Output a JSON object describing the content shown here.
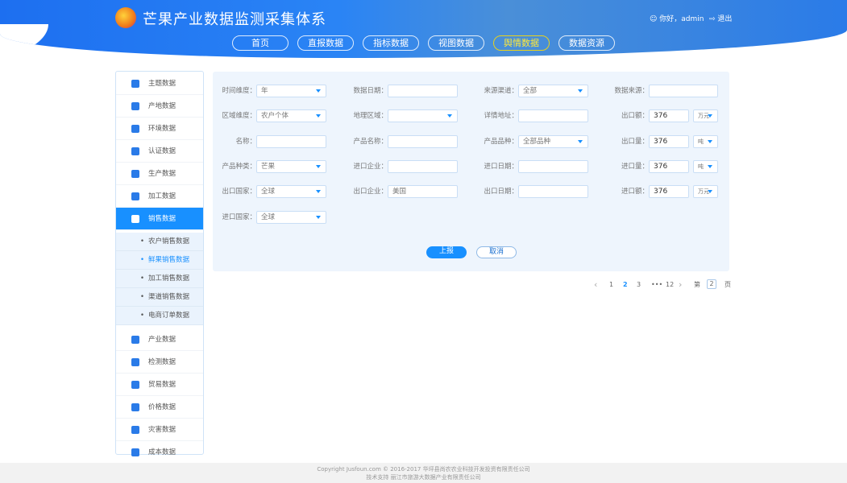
{
  "header": {
    "title": "芒果产业数据监测采集体系",
    "user": "你好，admin",
    "logout": "退出",
    "nav": [
      {
        "label": "首页"
      },
      {
        "label": "直报数据"
      },
      {
        "label": "指标数据"
      },
      {
        "label": "视图数据"
      },
      {
        "label": "舆情数据",
        "active": true
      },
      {
        "label": "数据资源"
      }
    ]
  },
  "sidebar": {
    "items": [
      "主题数据",
      "产地数据",
      "环境数据",
      "认证数据",
      "生产数据",
      "加工数据",
      "销售数据"
    ],
    "sub": [
      "农户销售数据",
      "鲜果销售数据",
      "加工销售数据",
      "渠道销售数据",
      "电商订单数据"
    ],
    "items2": [
      "产业数据",
      "检测数据",
      "贸易数据",
      "价格数据",
      "灾害数据",
      "成本数据"
    ],
    "active": "销售数据",
    "active_sub": "鲜果销售数据"
  },
  "form": {
    "fields": [
      {
        "label": "时间维度：",
        "value": "年",
        "select": true
      },
      {
        "label": "数据日期：",
        "value": ""
      },
      {
        "label": "来源渠道：",
        "value": "全部",
        "select": true
      },
      {
        "label": "数据来源：",
        "value": ""
      },
      {
        "label": "区域维度：",
        "value": "农户个体",
        "select": true
      },
      {
        "label": "地理区域：",
        "value": "",
        "select": true
      },
      {
        "label": "详情地址：",
        "value": ""
      },
      {
        "label": "出口额：",
        "value": "376",
        "unit": "万元"
      },
      {
        "label": "名称：",
        "value": ""
      },
      {
        "label": "产品名称：",
        "value": ""
      },
      {
        "label": "产品品种：",
        "value": "全部品种",
        "select": true
      },
      {
        "label": "出口量：",
        "value": "376",
        "unit": "吨"
      },
      {
        "label": "产品种类：",
        "value": "芒果",
        "select": true
      },
      {
        "label": "进口企业：",
        "value": ""
      },
      {
        "label": "进口日期：",
        "value": ""
      },
      {
        "label": "进口量：",
        "value": "376",
        "unit": "吨"
      },
      {
        "label": "出口国家：",
        "value": "全球",
        "select": true
      },
      {
        "label": "出口企业：",
        "value": "美国"
      },
      {
        "label": "出口日期：",
        "value": ""
      },
      {
        "label": "进口额：",
        "value": "376",
        "unit": "万元"
      },
      {
        "label": "进口国家：",
        "value": "全球",
        "select": true
      }
    ],
    "submit": "上报",
    "cancel": "取消"
  },
  "pagination": {
    "pages": [
      "1",
      "2",
      "3",
      "•••",
      "12"
    ],
    "current": "2",
    "prefix": "第",
    "input": "2",
    "suffix": "页"
  },
  "footer": {
    "line1": "Copyright Jusfoun.com © 2016-2017   华坪县尚农农业科技开发投资有限责任公司",
    "line2": "技术支持 丽江市旅游大数据产业有限责任公司"
  },
  "colors": {
    "primary": "#1890ff",
    "header": "#2a7be8",
    "nav_active": "#ffe93a"
  }
}
